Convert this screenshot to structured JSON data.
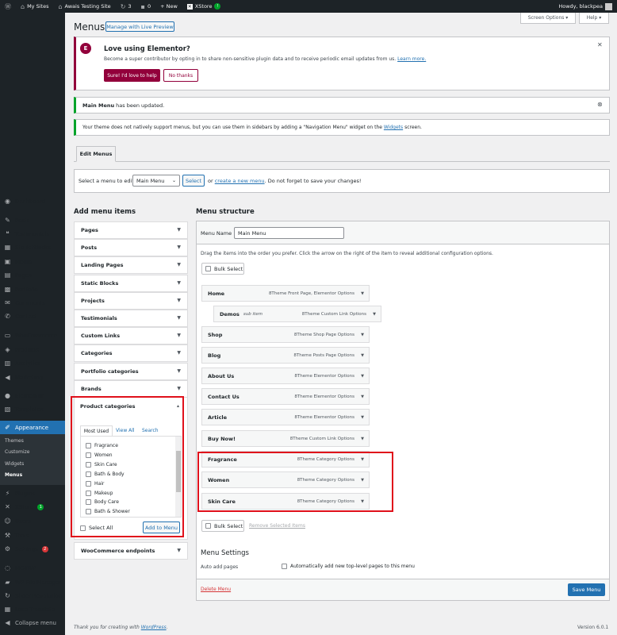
{
  "adminbar": {
    "my_sites": "My Sites",
    "site_name": "Awais Testing Site",
    "updates": "3",
    "comments": "0",
    "new": "+ New",
    "xstore": "XStore",
    "xstore_badge": "!",
    "howdy": "Howdy, blackpea"
  },
  "sidebar": {
    "items": [
      {
        "label": "Dashboard",
        "icon": "dashboard-icon",
        "glyph": "◉"
      },
      {
        "label": "Posts",
        "icon": "pin-icon",
        "glyph": "✎"
      },
      {
        "label": "Testimonials",
        "icon": "quote-icon",
        "glyph": "❝"
      },
      {
        "label": "Static Blocks",
        "icon": "blocks-icon",
        "glyph": "▦"
      },
      {
        "label": "Media",
        "icon": "media-icon",
        "glyph": "▣"
      },
      {
        "label": "Pages",
        "icon": "page-icon",
        "glyph": "▤"
      },
      {
        "label": "Portfolio",
        "icon": "portfolio-icon",
        "glyph": "▩"
      },
      {
        "label": "Comments",
        "icon": "comment-icon",
        "glyph": "✉"
      },
      {
        "label": "Contact",
        "icon": "contact-icon",
        "glyph": "✆"
      },
      {
        "label": "WooCommerce",
        "icon": "woo-icon",
        "glyph": "▭"
      },
      {
        "label": "Products",
        "icon": "products-icon",
        "glyph": "◈"
      },
      {
        "label": "Analytics",
        "icon": "analytics-icon",
        "glyph": "▥"
      },
      {
        "label": "Marketing",
        "icon": "marketing-icon",
        "glyph": "◀"
      },
      {
        "label": "Elementor",
        "icon": "elementor-icon",
        "glyph": "●"
      },
      {
        "label": "Templates",
        "icon": "templates-icon",
        "glyph": "▧"
      },
      {
        "label": "Appearance",
        "icon": "brush-icon",
        "glyph": "✐"
      },
      {
        "label": "Plugins",
        "icon": "plugin-icon",
        "glyph": "⚡"
      },
      {
        "label": "XStore",
        "icon": "xstore-icon",
        "glyph": "✕"
      },
      {
        "label": "Users",
        "icon": "users-icon",
        "glyph": "☺"
      },
      {
        "label": "Tools",
        "icon": "tools-icon",
        "glyph": "⚒"
      },
      {
        "label": "Settings",
        "icon": "settings-icon",
        "glyph": "⚙"
      },
      {
        "label": "MC4WP",
        "icon": "mc4wp-icon",
        "glyph": "◌"
      },
      {
        "label": "WP File Manager",
        "icon": "folder-icon",
        "glyph": "▰"
      },
      {
        "label": "Slider Revolution",
        "icon": "slider-icon",
        "glyph": "↻"
      },
      {
        "label": "Loco Translate",
        "icon": "translate-icon",
        "glyph": "▦"
      },
      {
        "label": "Collapse menu",
        "icon": "collapse-icon",
        "glyph": "◀"
      }
    ],
    "xstore_badge": "1",
    "settings_badge": "2",
    "appearance_sub": [
      "Themes",
      "Customize",
      "Widgets",
      "Menus"
    ]
  },
  "header": {
    "title": "Menus",
    "live_preview": "Manage with Live Preview",
    "screen_options": "Screen Options ▾",
    "help": "Help ▾"
  },
  "elementor_notice": {
    "title": "Love using Elementor?",
    "text_before": "Become a super contributor by opting in to share non-sensitive plugin data and to receive periodic email updates from us. ",
    "learn_more": "Learn more.",
    "yes": "Sure! I'd love to help",
    "no": "No thanks",
    "close": "✕"
  },
  "updated_notice": {
    "bold": "Main Menu",
    "rest": " has been updated.",
    "close": "⊗"
  },
  "theme_notice": {
    "before": "Your theme does not natively support menus, but you can use them in sidebars by adding a \"Navigation Menu\" widget on the ",
    "link": "Widgets",
    "after": " screen."
  },
  "tab": {
    "edit_menus": "Edit Menus"
  },
  "select_bar": {
    "label": "Select a menu to edit:",
    "selected": "Main Menu",
    "select_btn": "Select",
    "or": "or",
    "create_link": "create a new menu",
    "after": ". Do not forget to save your changes!"
  },
  "add_items": {
    "heading": "Add menu items",
    "sections": [
      "Pages",
      "Posts",
      "Landing Pages",
      "Static Blocks",
      "Projects",
      "Testimonials",
      "Custom Links",
      "Categories",
      "Portfolio categories",
      "Brands"
    ],
    "product_categories": {
      "title": "Product categories",
      "tabs": [
        "Most Used",
        "View All",
        "Search"
      ],
      "items": [
        "Fragrance",
        "Women",
        "Skin Care",
        "Bath & Body",
        "Hair",
        "Makeup",
        "Body Care",
        "Bath & Shower"
      ],
      "select_all": "Select All",
      "add_btn": "Add to Menu"
    },
    "woo_endpoints": "WooCommerce endpoints"
  },
  "structure": {
    "heading": "Menu structure",
    "menu_name_label": "Menu Name",
    "menu_name_value": "Main Menu",
    "instructions": "Drag the items into the order you prefer. Click the arrow on the right of the item to reveal additional configuration options.",
    "bulk_select": "Bulk Select",
    "items": [
      {
        "label": "Home",
        "sub": "",
        "type": "8Theme Front Page, Elementor Options"
      },
      {
        "label": "Demos",
        "sub": "sub item",
        "type": "8Theme Custom Link Options"
      },
      {
        "label": "Shop",
        "sub": "",
        "type": "8Theme Shop Page Options"
      },
      {
        "label": "Blog",
        "sub": "",
        "type": "8Theme Posts Page Options"
      },
      {
        "label": "About Us",
        "sub": "",
        "type": "8Theme Elementor Options"
      },
      {
        "label": "Contact Us",
        "sub": "",
        "type": "8Theme Elementor Options"
      },
      {
        "label": "Article",
        "sub": "",
        "type": "8Theme Elementor Options"
      },
      {
        "label": "Buy Now!",
        "sub": "",
        "type": "8Theme Custom Link Options"
      },
      {
        "label": "Fragrance",
        "sub": "",
        "type": "8Theme Category Options"
      },
      {
        "label": "Women",
        "sub": "",
        "type": "8Theme Category Options"
      },
      {
        "label": "Skin Care",
        "sub": "",
        "type": "8Theme Category Options"
      }
    ],
    "remove_selected": "Remove Selected Items",
    "settings_heading": "Menu Settings",
    "auto_add_label": "Auto add pages",
    "auto_add_text": "Automatically add new top-level pages to this menu",
    "delete": "Delete Menu",
    "save": "Save Menu"
  },
  "footer": {
    "before": "Thank you for creating with ",
    "link": "WordPress",
    "after": ".",
    "version": "Version 6.0.1"
  },
  "colors": {
    "accent": "#2271b1",
    "highlight": "#e0101b",
    "elementor": "#92003b",
    "success": "#00a32a"
  }
}
